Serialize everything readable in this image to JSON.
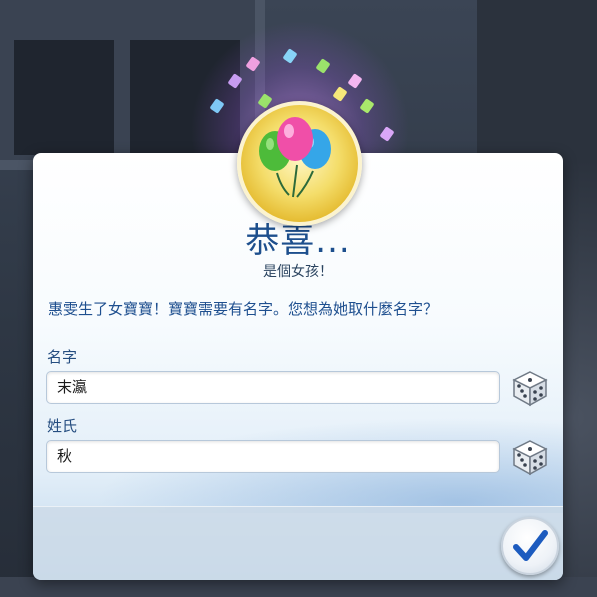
{
  "dialog": {
    "title": "恭喜...",
    "subtitle": "是個女孩！",
    "message": "惠雯生了女寶寶！寶寶需要有名字。您想為她取什麼名字？",
    "first_name": {
      "label": "名字",
      "value": "末瀛"
    },
    "last_name": {
      "label": "姓氏",
      "value": "秋"
    },
    "randomize_icon": "dice-icon",
    "confirm_icon": "checkmark-icon",
    "badge_icon": "balloons-icon"
  },
  "colors": {
    "title": "#1d4f8d",
    "accent": "#1e4f8f",
    "badge_gold": "#e2b526",
    "check_blue": "#1c5bbf"
  }
}
